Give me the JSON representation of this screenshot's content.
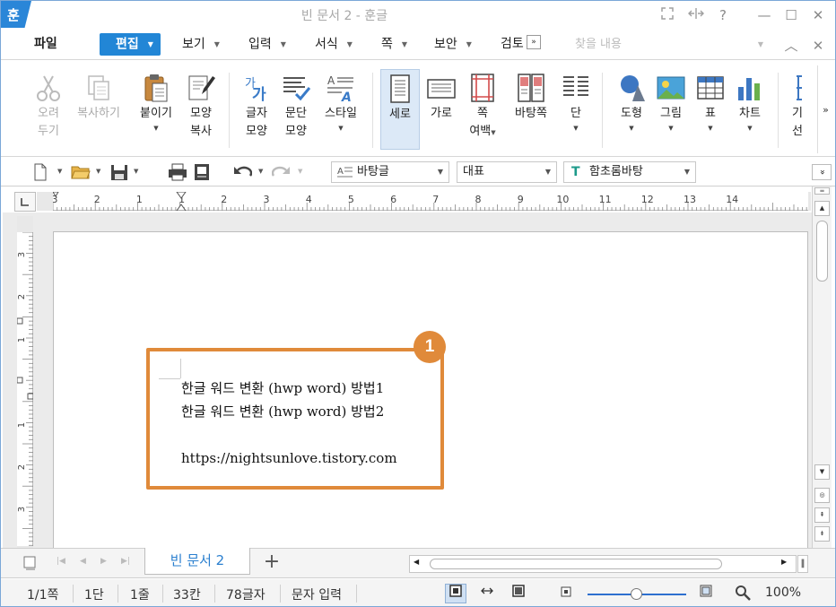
{
  "window": {
    "title": "빈 문서 2 - 훈글",
    "logo_char": "훈",
    "help_label": "?",
    "minimize_label": "—",
    "maximize_label": "☐",
    "close_label": "✕"
  },
  "menu": {
    "file": "파일",
    "items": [
      {
        "label": "편집",
        "active": true
      },
      {
        "label": "보기"
      },
      {
        "label": "입력"
      },
      {
        "label": "서식"
      },
      {
        "label": "쪽"
      },
      {
        "label": "보안"
      },
      {
        "label": "검토"
      }
    ],
    "more": "»",
    "find_placeholder": "찾을 내용",
    "collapse_label": "︿",
    "close_label": "✕"
  },
  "ribbon": {
    "cut": {
      "line1": "오려",
      "line2": "두기"
    },
    "copy": {
      "line1": "복사하기"
    },
    "paste": {
      "line1": "붙이기"
    },
    "format_copy": {
      "line1": "모양",
      "line2": "복사"
    },
    "char_shape": {
      "line1": "글자",
      "line2": "모양"
    },
    "para_shape": {
      "line1": "문단",
      "line2": "모양"
    },
    "style": {
      "line1": "스타일"
    },
    "portrait": {
      "line1": "세로"
    },
    "landscape": {
      "line1": "가로"
    },
    "page_margin": {
      "line1": "쪽",
      "line2": "여백"
    },
    "master_page": {
      "line1": "바탕쪽"
    },
    "columns": {
      "line1": "단"
    },
    "shape": {
      "line1": "도형"
    },
    "picture": {
      "line1": "그림"
    },
    "table": {
      "line1": "표"
    },
    "chart": {
      "line1": "차트"
    },
    "partial": {
      "line1": "기",
      "line2": "선"
    },
    "more": "»"
  },
  "toolbar": {
    "style_combo": "바탕글",
    "lang_combo": "대표",
    "font_combo": "함초롬바탕",
    "expand": "»"
  },
  "ruler": {
    "h_ticks": [
      "3",
      "2",
      "1",
      "1",
      "2",
      "3",
      "4",
      "5",
      "6",
      "7",
      "8",
      "9",
      "10",
      "11",
      "12",
      "13",
      "14"
    ],
    "v_ticks": [
      "3",
      "2",
      "1",
      "1",
      "2",
      "3"
    ]
  },
  "document": {
    "lines": [
      "한글 워드 변환 (hwp word) 방법1",
      "한글 워드 변환 (hwp word) 방법2",
      "",
      "https://nightsunlove.tistory.com"
    ],
    "annotation_number": "1",
    "annotation_color": "#e08a3a"
  },
  "tabs": {
    "doc_tab": "빈 문서 2",
    "add": "+"
  },
  "status": {
    "page": "1/1쪽",
    "column": "1단",
    "line": "1줄",
    "position": "33칸",
    "chars": "78글자",
    "mode": "문자 입력",
    "zoom": "100%",
    "zoom_fraction": 0.5
  },
  "colors": {
    "accent": "#2286d6",
    "highlight": "#e08a3a"
  }
}
